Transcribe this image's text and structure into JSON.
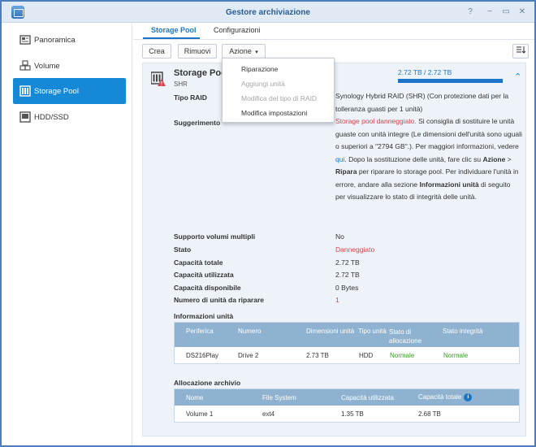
{
  "window": {
    "title": "Gestore archiviazione",
    "controls": [
      "?",
      "−",
      "▭",
      "✕"
    ]
  },
  "sidebar": {
    "items": [
      {
        "label": "Panoramica",
        "icon": "overview-icon"
      },
      {
        "label": "Volume",
        "icon": "cubes-icon"
      },
      {
        "label": "Storage Pool",
        "icon": "storage-pool-icon",
        "active": true
      },
      {
        "label": "HDD/SSD",
        "icon": "drive-icon"
      }
    ]
  },
  "tabs": [
    {
      "label": "Storage Pool",
      "active": true
    },
    {
      "label": "Configurazioni"
    }
  ],
  "toolbar": {
    "create": "Crea",
    "remove": "Rimuovi",
    "action": "Azione",
    "action_caret": "▾"
  },
  "dropdown": {
    "items": [
      {
        "label": "Riparazione",
        "enabled": true
      },
      {
        "label": "Aggiungi unità",
        "enabled": false
      },
      {
        "label": "Modifica del tipo di RAID",
        "enabled": false
      },
      {
        "label": "Modifica impostazioni",
        "enabled": true
      }
    ]
  },
  "pool": {
    "title": "Storage Pool 1",
    "subtitle": "SHR",
    "capacity_label": "2.72 TB / 2.72 TB",
    "capacity_used_fraction": 1.0,
    "fields": {
      "raid_type": {
        "label": "Tipo RAID",
        "value": "Synology Hybrid RAID (SHR) (Con protezione dati per la tolleranza guasti per 1 unità)"
      },
      "suggestion": {
        "label": "Suggerimento",
        "p1_red": "Storage pool danneggiato.",
        "p2": " Si consiglia di sostituire le unità guaste con unità integre (Le dimensioni dell'unità sono uguali o superiori a \"2794 GB\".). Per maggiori informazioni, vedere ",
        "p3_link": "qui",
        "p4": ". Dopo la sostituzione delle unità, fare clic su ",
        "p5_bold": "Azione",
        "p6": " > ",
        "p7_bold": "Ripara",
        "p8": " per riparare lo storage pool. Per individuare l'unità in errore, andare alla sezione ",
        "p9_bold": "Informazioni unità",
        "p10": " di seguito per visualizzare lo stato di integrità delle unità."
      },
      "multi_volume": {
        "label": "Supporto volumi multipli",
        "value": "No"
      },
      "status": {
        "label": "Stato",
        "value": "Danneggiato"
      },
      "total": {
        "label": "Capacità totale",
        "value": "2.72 TB"
      },
      "used": {
        "label": "Capacità utilizzata",
        "value": "2.72 TB"
      },
      "available": {
        "label": "Capacità disponibile",
        "value": "0 Bytes"
      },
      "repair_count": {
        "label": "Numero di unità da riparare",
        "value": "1"
      }
    }
  },
  "drive_info": {
    "title": "Informazioni unità",
    "headers": [
      "Periferica",
      "Numero",
      "Dimensioni unità",
      "Tipo unità",
      "Stato di allocazione",
      "Stato integrità"
    ],
    "rows": [
      [
        "DS216Play",
        "Drive 2",
        "2.73 TB",
        "HDD",
        "Normale",
        "Normale"
      ]
    ]
  },
  "allocation": {
    "title": "Allocazione archivio",
    "headers": [
      "Nome",
      "File System",
      "Capacità utilizzata",
      "Capacità totale"
    ],
    "info_icon": "i",
    "rows": [
      [
        "Volume 1",
        "ext4",
        "1.35 TB",
        "2.68 TB"
      ]
    ]
  },
  "colors": {
    "accent": "#1a75c8",
    "danger": "#d9434d",
    "ok": "#3a9a28",
    "sidebar_active": "#1689d6"
  }
}
